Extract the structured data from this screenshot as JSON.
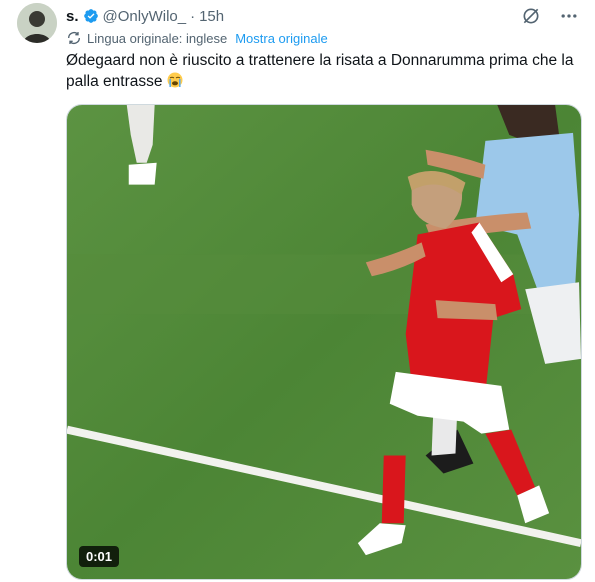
{
  "author": {
    "name": "s.",
    "handle": "@OnlyWilo_",
    "separator": "·",
    "time": "15h"
  },
  "icons": {
    "verified": "verified-badge-icon",
    "grok": "grok-icon",
    "more": "more-icon",
    "translate": "translate-icon",
    "emoji": "loudly-crying-face-emoji"
  },
  "translation": {
    "source_label": "Lingua originale: inglese",
    "show_original": "Mostra originale"
  },
  "tweet": {
    "text": "Ødegaard non è riuscito a trattenere la risata a Donnarumma prima che la palla entrasse"
  },
  "video": {
    "duration": "0:01"
  },
  "colors": {
    "accent": "#1d9bf0",
    "pitch": "#4f8a3a",
    "arsenal_red": "#d9161c",
    "city_blue": "#9cc8ea"
  }
}
